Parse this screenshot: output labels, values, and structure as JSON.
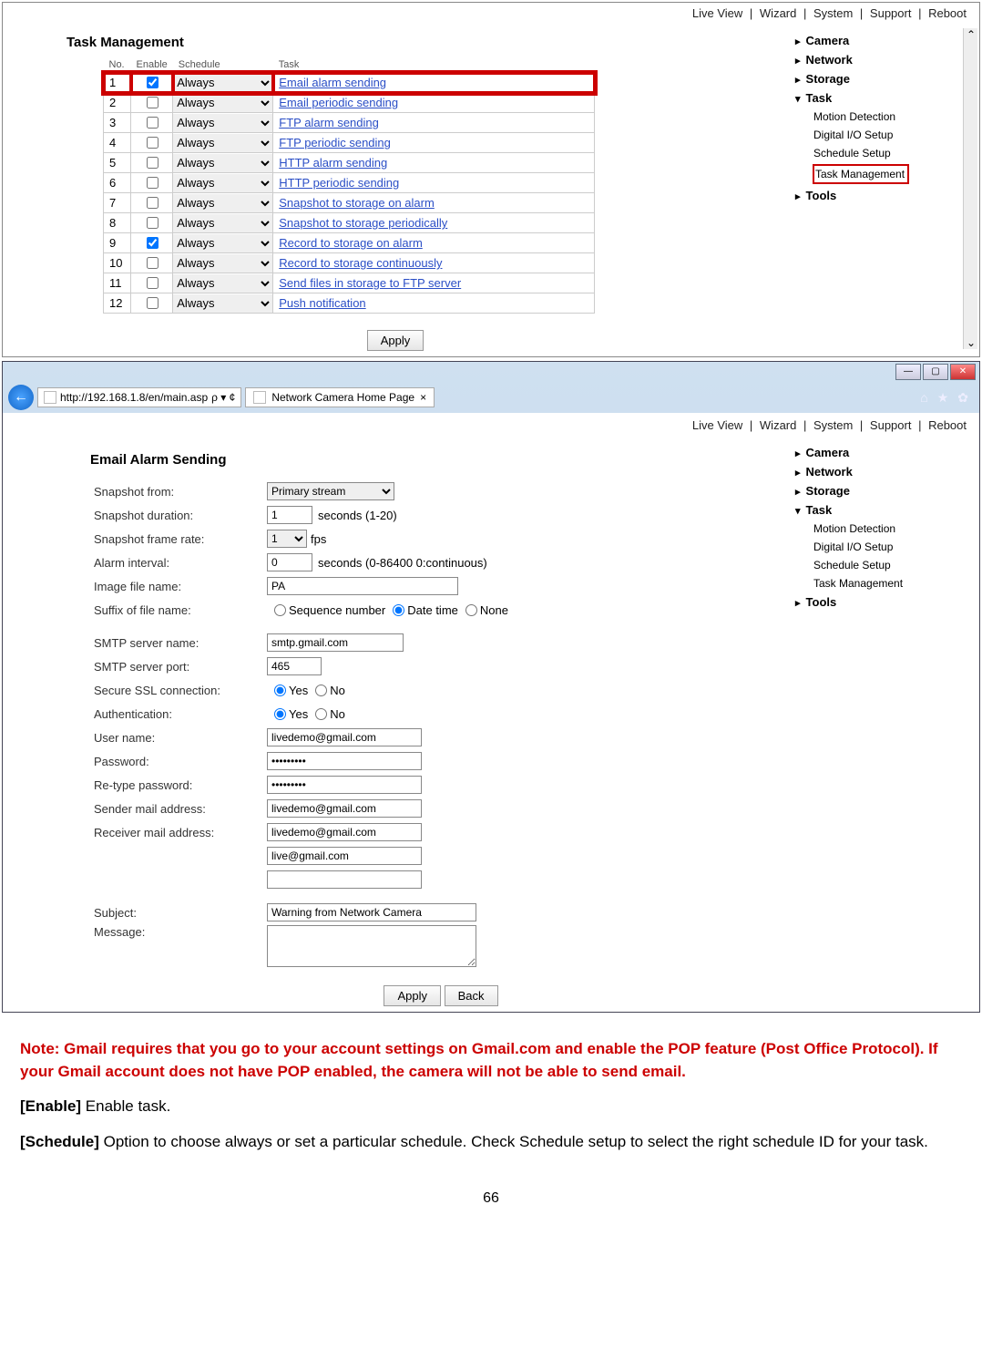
{
  "topnav": [
    "Live View",
    "Wizard",
    "System",
    "Support",
    "Reboot"
  ],
  "sidebar1": {
    "items": [
      "Camera",
      "Network",
      "Storage",
      "Task",
      "Tools"
    ],
    "open_index": 3,
    "subs": [
      "Motion Detection",
      "Digital I/O Setup",
      "Schedule Setup",
      "Task Management"
    ],
    "highlight_sub": 3
  },
  "task_mgmt": {
    "title": "Task Management",
    "headers": [
      "No.",
      "Enable",
      "Schedule",
      "Task"
    ],
    "apply": "Apply",
    "rows": [
      {
        "no": "1",
        "enabled": true,
        "schedule": "Always",
        "task": "Email alarm sending",
        "hl": true
      },
      {
        "no": "2",
        "enabled": false,
        "schedule": "Always",
        "task": "Email periodic sending"
      },
      {
        "no": "3",
        "enabled": false,
        "schedule": "Always",
        "task": "FTP alarm sending"
      },
      {
        "no": "4",
        "enabled": false,
        "schedule": "Always",
        "task": "FTP periodic sending"
      },
      {
        "no": "5",
        "enabled": false,
        "schedule": "Always",
        "task": "HTTP alarm sending"
      },
      {
        "no": "6",
        "enabled": false,
        "schedule": "Always",
        "task": "HTTP periodic sending"
      },
      {
        "no": "7",
        "enabled": false,
        "schedule": "Always",
        "task": "Snapshot to storage on alarm"
      },
      {
        "no": "8",
        "enabled": false,
        "schedule": "Always",
        "task": "Snapshot to storage periodically"
      },
      {
        "no": "9",
        "enabled": true,
        "schedule": "Always",
        "task": "Record to storage on alarm"
      },
      {
        "no": "10",
        "enabled": false,
        "schedule": "Always",
        "task": "Record to storage continuously"
      },
      {
        "no": "11",
        "enabled": false,
        "schedule": "Always",
        "task": "Send files in storage to FTP server"
      },
      {
        "no": "12",
        "enabled": false,
        "schedule": "Always",
        "task": "Push notification"
      }
    ]
  },
  "browser": {
    "url": "http://192.168.1.8/en/main.asp",
    "search_suffix": "  ρ ▾ ¢",
    "tab_title": "Network Camera Home Page",
    "tab_close": "×",
    "icons": [
      "⌂",
      "★",
      "✿"
    ]
  },
  "sidebar2": {
    "items": [
      "Camera",
      "Network",
      "Storage",
      "Task",
      "Tools"
    ],
    "open_index": 3,
    "subs": [
      "Motion Detection",
      "Digital I/O Setup",
      "Schedule Setup",
      "Task Management"
    ]
  },
  "email_form": {
    "title": "Email Alarm Sending",
    "labels": {
      "snapshot_from": "Snapshot from:",
      "snapshot_duration": "Snapshot duration:",
      "snapshot_fr": "Snapshot frame rate:",
      "alarm_interval": "Alarm interval:",
      "image_file": "Image file name:",
      "suffix": "Suffix of file name:",
      "smtp_server": "SMTP server name:",
      "smtp_port": "SMTP server port:",
      "ssl": "Secure SSL connection:",
      "auth": "Authentication:",
      "user": "User name:",
      "pass": "Password:",
      "repass": "Re-type password:",
      "sender": "Sender mail address:",
      "receiver": "Receiver mail address:",
      "subject": "Subject:",
      "message": "Message:"
    },
    "values": {
      "snapshot_from": "Primary stream",
      "snapshot_duration": "1",
      "duration_hint": "seconds (1-20)",
      "fr": "1",
      "fr_suffix": "fps",
      "alarm_interval": "0",
      "interval_hint": "seconds (0-86400 0:continuous)",
      "image_file": "PA",
      "suffix_opts": [
        "Sequence number",
        "Date time",
        "None"
      ],
      "suffix_sel": 1,
      "smtp_server": "smtp.gmail.com",
      "smtp_port": "465",
      "yes": "Yes",
      "no": "No",
      "ssl_sel": "yes",
      "auth_sel": "yes",
      "user": "livedemo@gmail.com",
      "pass": "•••••••••",
      "repass": "•••••••••",
      "sender": "livedemo@gmail.com",
      "receiver1": "livedemo@gmail.com",
      "receiver2": "live@gmail.com",
      "receiver3": "",
      "subject": "Warning from Network Camera",
      "message": ""
    },
    "apply": "Apply",
    "back": "Back"
  },
  "doc": {
    "note": "Note: Gmail requires that you go to your account settings on Gmail.com and enable the POP feature (Post Office Protocol). If your Gmail account does not have POP enabled, the camera will not be able to send email.",
    "enable_label": "[Enable]",
    "enable_text": " Enable task.",
    "schedule_label": "[Schedule]",
    "schedule_text": " Option to choose always or set a particular schedule. Check Schedule setup to select the right schedule ID for your task.",
    "page": "66"
  }
}
